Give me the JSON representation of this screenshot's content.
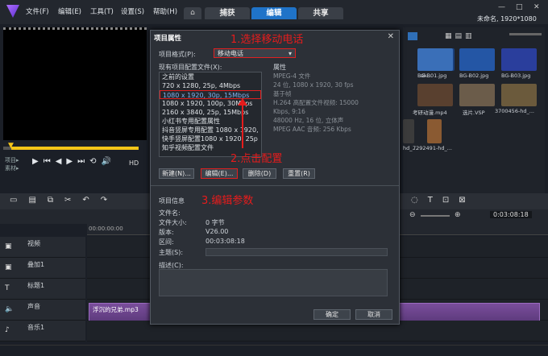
{
  "menubar": {
    "items": [
      "文件(F)",
      "编辑(E)",
      "工具(T)",
      "设置(S)",
      "帮助(H)"
    ],
    "tabs": [
      "捕获",
      "编辑",
      "共享"
    ],
    "active_tab": "编辑",
    "project_title": "未命名, 1920*1080"
  },
  "player": {
    "project_label": "项目▸",
    "clip_label": "素材▸",
    "hd_label": "HD"
  },
  "library": {
    "thumbs": [
      {
        "label": ".ak...",
        "color": "#1a3f7a"
      },
      {
        "label": "BG-B01.jpg",
        "color": "#3a6fb8"
      },
      {
        "label": "BG-B02.jpg",
        "color": "#2456a5"
      },
      {
        "label": "BG-B03.jpg",
        "color": "#2a3e9c"
      },
      {
        "label": "考研动漫.mp4",
        "color": "#59402f"
      },
      {
        "label": "选片.VSP",
        "color": "#6b5c4a"
      },
      {
        "label": "3700456-hd_...",
        "color": "#6b5a3c"
      },
      {
        "label": "hd_...",
        "color": "#3b3b3b"
      },
      {
        "label": "7292491-hd_...",
        "color": "#8a5a32"
      }
    ]
  },
  "dialog": {
    "title": "项目属性",
    "format_label": "项目格式(P):",
    "format_value": "移动电话",
    "existing_label": "现有项目配置文件(X):",
    "props_label": "属性",
    "profiles": [
      "之前的设置",
      "720 x 1280, 25p, 4Mbps",
      "1080 x 1920, 30p, 15Mbps",
      "1080 x 1920, 100p, 30Mbps",
      "2160 x 3840, 25p, 15Mbps",
      "小红书专用配置属性",
      "抖音竖屏专用配置 1080 x 1920,",
      "快手竖屏配置1080 x 1920, 25p",
      "知乎视频配置文件"
    ],
    "selected_profile": "1080 x 1920, 30p, 15Mbps",
    "properties": [
      "MPEG-4 文件",
      "24 位, 1080 x 1920, 30 fps",
      "基于帧",
      "H.264 高配置文件视频: 15000",
      "Kbps, 9:16",
      "48000 Hz, 16 位, 立体声",
      "MPEG AAC 音频: 256 Kbps"
    ],
    "buttons": {
      "new": "新建(N)...",
      "edit": "编辑(E)...",
      "delete": "删除(D)",
      "reset": "重置(R)"
    },
    "info_title": "项目信息",
    "info": {
      "filename_label": "文件名:",
      "filesize_label": "文件大小:",
      "filesize_value": "0 字节",
      "version_label": "版本:",
      "version_value": "V26.00",
      "range_label": "区间:",
      "range_value": "00:03:08:18",
      "subject_label": "主题(S):",
      "desc_label": "描述(C):"
    },
    "ok": "确定",
    "cancel": "取消"
  },
  "annotations": {
    "step1": "1.选择移动电话",
    "step2": "2.点击配置",
    "step3": "3.编辑参数"
  },
  "timeline": {
    "tracks": [
      "视频",
      "叠加1",
      "标题1",
      "声音",
      "音乐1"
    ],
    "ruler_start": "00:00:00:00",
    "audio_clip": "浮沉的兄弟.mp3",
    "timecode": "0:03:08:18"
  }
}
